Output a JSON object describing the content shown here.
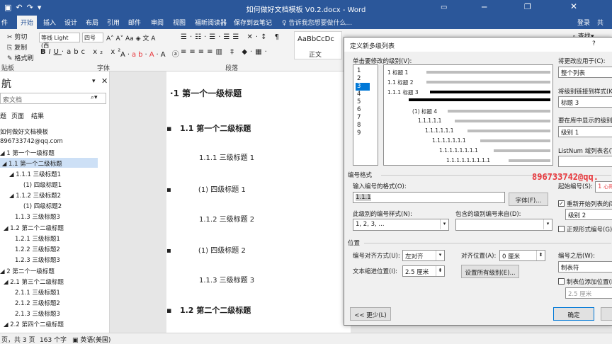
{
  "window": {
    "title": "如何做好文档模板 V0.2.docx - Word",
    "login": "登录",
    "share": "共",
    "help_search": "告诉我您想要做什么..."
  },
  "tabs": [
    "开始",
    "插入",
    "设计",
    "布局",
    "引用",
    "邮件",
    "审阅",
    "视图",
    "福昕阅读器",
    "保存到云笔记"
  ],
  "ribbon": {
    "cut": "剪切",
    "copy": "复制",
    "format_painter": "格式刷",
    "font_name": "等线 Light (西",
    "font_size": "四号",
    "font_group_label": "字体",
    "paragraph_group_label": "段落",
    "clipboard_label": "贴板",
    "style_preview": "AaBbCcDc",
    "style_name": "正文",
    "style_preview2": "Aa",
    "find_label": "查找"
  },
  "nav": {
    "title": "航",
    "search_placeholder": "索文档",
    "tabs": [
      "题",
      "页面",
      "结果"
    ],
    "items": [
      {
        "label": "如何做好文档模板",
        "selected": false
      },
      {
        "label": "896733742@qq.com",
        "selected": false
      },
      {
        "label": "1 第一个一级标题",
        "selected": false
      },
      {
        "label": "1.1 第一个二级标题",
        "selected": true
      },
      {
        "label": "1.1.1 三级标题1",
        "selected": false
      },
      {
        "label": "(1) 四级标题1",
        "selected": false
      },
      {
        "label": "1.1.2 三级标题2",
        "selected": false
      },
      {
        "label": "(1) 四级标题2",
        "selected": false
      },
      {
        "label": "1.1.3 三级标题3",
        "selected": false
      },
      {
        "label": "1.2 第二个二级标题",
        "selected": false
      },
      {
        "label": "1.2.1 三级标题1",
        "selected": false
      },
      {
        "label": "1.2.2 三级标题2",
        "selected": false
      },
      {
        "label": "1.2.3 三级标题3",
        "selected": false
      },
      {
        "label": "2 第二个一级标题",
        "selected": false
      },
      {
        "label": "2.1 第三个二级标题",
        "selected": false
      },
      {
        "label": "2.1.1 三级标题1",
        "selected": false
      },
      {
        "label": "2.1.2 三级标题2",
        "selected": false
      },
      {
        "label": "2.1.3 三级标题3",
        "selected": false
      },
      {
        "label": "2.2 第四个二级标题",
        "selected": false
      }
    ]
  },
  "document": {
    "lines": [
      "1   第一个一级标题",
      "1.1   第一个二级标题",
      "1.1.1 三级标题 1",
      "(1)      四级标题 1",
      "1.1.2 三级标题 2",
      "(1)      四级标题 2",
      "1.1.3 三级标题 3",
      "1.2   第二个二级标题"
    ]
  },
  "status": {
    "pages": "页，共 3 页",
    "words": "163 个字",
    "language": "英语(美国)"
  },
  "dialog": {
    "title": "定义新多级列表",
    "help": "?",
    "levels_label": "单击要修改的级别(V):",
    "levels": [
      "1",
      "2",
      "3",
      "4",
      "5",
      "6",
      "7",
      "8",
      "9"
    ],
    "selected_level": "3",
    "preview": [
      "1  标题 1",
      "1.1  标题 2",
      "1.1.1  标题 3",
      "(1)  标题 4",
      "1.1.1.1.1",
      "1.1.1.1.1.1",
      "1.1.1.1.1.1.1",
      "1.1.1.1.1.1.1.1",
      "1.1.1.1.1.1.1.1.1"
    ],
    "apply_to_label": "将更改应用于(C):",
    "apply_to_value": "整个列表",
    "link_style_label": "将级别链接到样式(K):",
    "link_style_value": "标题 3",
    "gallery_level_label": "要在库中显示的级别(H):",
    "gallery_level_value": "级别 1",
    "listnum_label": "ListNum 域列表名(T):",
    "number_format_section": "编号格式",
    "enter_format_label": "输入编号的格式(O):",
    "enter_format_value": "1.1.1",
    "font_button": "字体(F)...",
    "start_at_label": "起始编号(S):",
    "start_at_value": "1",
    "restart_label": "重新开始列表的间隔(R):",
    "restart_value": "级别 2",
    "legal_label": "正规形式编号(G)",
    "number_style_label": "此级别的编号样式(N):",
    "number_style_value": "1, 2, 3, ...",
    "include_level_label": "包含的级别编号来自(D):",
    "position_section": "位置",
    "alignment_label": "编号对齐方式(U):",
    "alignment_value": "左对齐",
    "aligned_at_label": "对齐位置(A):",
    "aligned_at_value": "0 厘米",
    "indent_label": "文本缩进位置(I):",
    "indent_value": "2.5 厘米",
    "set_all_button": "设置所有级别(E)...",
    "follow_label": "编号之后(W):",
    "follow_value": "制表符",
    "tab_stop_label": "制表位添加位置(B):",
    "tab_stop_value": "2.5 厘米",
    "less_button": "<< 更少(L)",
    "ok_button": "确定",
    "watermark": "896733742@qq.",
    "watermark2": "心哥"
  }
}
